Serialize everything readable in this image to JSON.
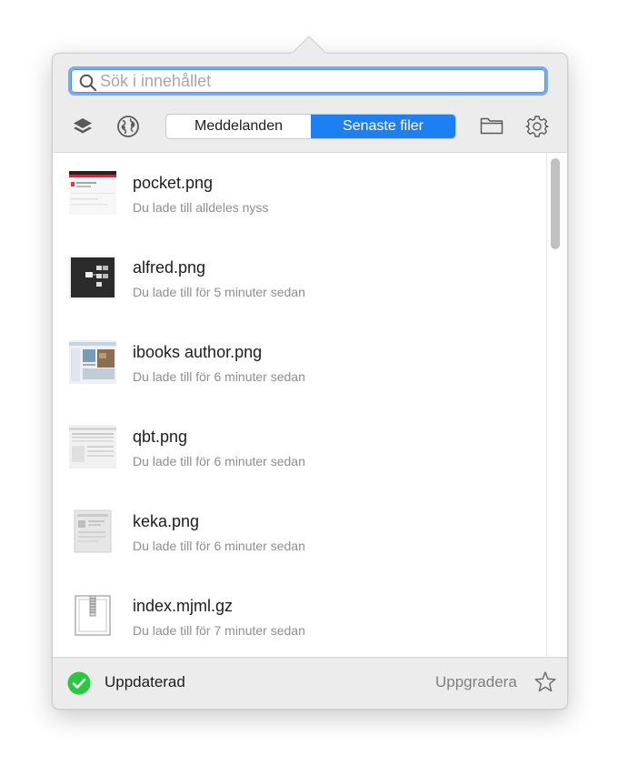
{
  "search": {
    "placeholder": "Sök i innehållet",
    "value": ""
  },
  "toolbar": {
    "left_icons": [
      "layers-icon",
      "globe-icon"
    ],
    "right_icons": [
      "folder-icon",
      "gear-icon"
    ]
  },
  "tabs": [
    {
      "label": "Meddelanden",
      "active": false
    },
    {
      "label": "Senaste filer",
      "active": true
    }
  ],
  "files": [
    {
      "name": "pocket.png",
      "time": "Du lade till alldeles nyss",
      "thumb": "pocket-thumbnail"
    },
    {
      "name": "alfred.png",
      "time": "Du lade till för 5 minuter sedan",
      "thumb": "alfred-thumbnail"
    },
    {
      "name": "ibooks author.png",
      "time": "Du lade till för 6 minuter sedan",
      "thumb": "ibooks-thumbnail"
    },
    {
      "name": "qbt.png",
      "time": "Du lade till för 6 minuter sedan",
      "thumb": "qbt-thumbnail"
    },
    {
      "name": "keka.png",
      "time": "Du lade till för 6 minuter sedan",
      "thumb": "keka-thumbnail"
    },
    {
      "name": "index.mjml.gz",
      "time": "Du lade till för 7 minuter sedan",
      "thumb": "archive-icon"
    }
  ],
  "footer": {
    "status": "Uppdaterad",
    "status_icon": "check-circle-icon",
    "upgrade_label": "Uppgradera",
    "upgrade_icon": "star-icon"
  },
  "colors": {
    "accent": "#1c80f3",
    "status_ok": "#28c840",
    "search_focus": "#7aaaf0"
  }
}
